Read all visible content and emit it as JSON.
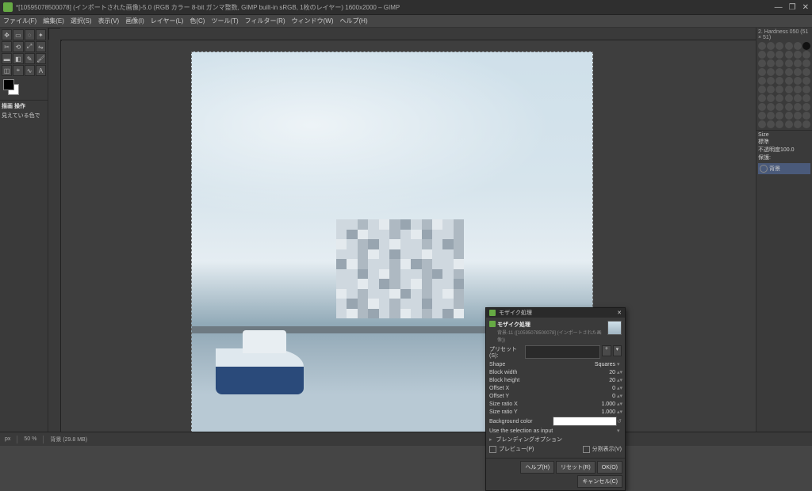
{
  "titlebar": {
    "title": "*[10595078500078] (インポートされた画像)-5.0 (RGB カラー 8-bit ガンマ整数, GIMP built-in sRGB, 1枚のレイヤー) 1600x2000 – GIMP"
  },
  "winbtns": {
    "min": "—",
    "max": "❐",
    "close": "✕"
  },
  "menu": {
    "file": "ファイル(F)",
    "edit": "編集(E)",
    "select": "選択(S)",
    "view": "表示(V)",
    "image": "画像(I)",
    "layer": "レイヤー(L)",
    "color": "色(C)",
    "tool": "ツール(T)",
    "filter": "フィルター(R)",
    "window": "ウィンドウ(W)",
    "help": "ヘルプ(H)"
  },
  "toolopt": {
    "header": "描画 操作",
    "sub": "見えている色で"
  },
  "brush": {
    "header": "2. Hardness 050 (51 × 51)"
  },
  "layers": {
    "mode": "標準",
    "op_label": "不透明度",
    "op_value": "100.0",
    "lock": "保護:",
    "layer_name": "背景",
    "size_label": "Size"
  },
  "dialog": {
    "title": "モザイク処理",
    "header": "モザイク処理",
    "subheader": "背景-11 ([10595078500078] (インポートされた画像))",
    "preset_label": "プリセット(S):",
    "fields": {
      "shape": {
        "label": "Shape",
        "value": "Squares"
      },
      "bw": {
        "label": "Block width",
        "value": "20"
      },
      "bh": {
        "label": "Block height",
        "value": "20"
      },
      "ox": {
        "label": "Offset X",
        "value": "0"
      },
      "oy": {
        "label": "Offset Y",
        "value": "0"
      },
      "srx": {
        "label": "Size ratio X",
        "value": "1.000"
      },
      "sry": {
        "label": "Size ratio Y",
        "value": "1.000"
      },
      "bg": {
        "label": "Background color"
      },
      "usesel": {
        "label": "Use the selection as input"
      }
    },
    "blend": "ブレンディングオプション",
    "preview": "プレビュー(P)",
    "split": "分割表示(V)",
    "btns": {
      "help": "ヘルプ(H)",
      "reset": "リセット(R)",
      "ok": "OK(O)",
      "cancel": "キャンセル(C)"
    }
  },
  "status": {
    "unit": "px",
    "zoom": "50 %",
    "layer": "背景 (29.8 MB)"
  }
}
